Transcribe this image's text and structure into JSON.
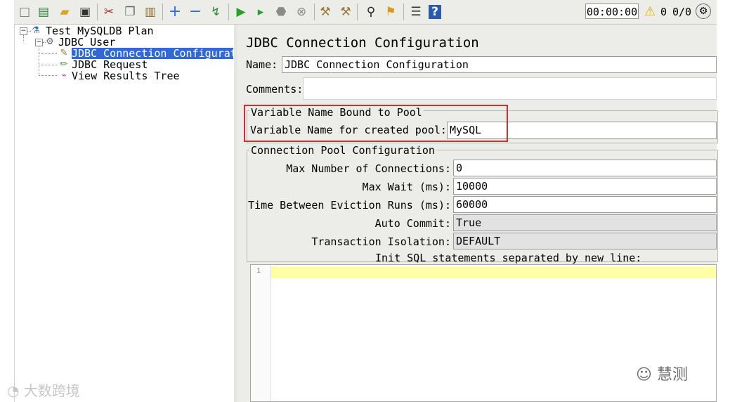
{
  "toolbar": {
    "icons": [
      "new-icon",
      "templates-icon",
      "open-icon",
      "save-icon",
      "cut-icon",
      "copy-icon",
      "paste-icon",
      "expand-icon",
      "collapse-icon",
      "toggle-icon",
      "start-icon",
      "start-no-pause-icon",
      "stop-icon",
      "shutdown-icon",
      "clear-icon",
      "clear-all-icon",
      "search-icon",
      "reset-search-icon",
      "function-helper-icon",
      "help-icon"
    ],
    "timer": "00:00:00",
    "warning_count": "0",
    "threads_ratio": "0/0"
  },
  "tree": {
    "items": [
      {
        "label": "Test MySQLDB Plan",
        "icon": "test-plan-icon"
      },
      {
        "label": "JDBC User",
        "icon": "thread-group-icon"
      },
      {
        "label": "JDBC Connection Configurati",
        "icon": "config-element-icon",
        "selected": true
      },
      {
        "label": "JDBC Request",
        "icon": "sampler-icon"
      },
      {
        "label": "View Results Tree",
        "icon": "listener-icon"
      }
    ]
  },
  "panel": {
    "title": "JDBC Connection Configuration",
    "name_label": "Name:",
    "name_value": "JDBC Connection Configuration",
    "comments_label": "Comments:",
    "comments_value": "",
    "var_group_title": "Variable Name Bound to Pool",
    "var_label": "Variable Name for created pool:",
    "var_value": "MySQL",
    "pool_group_title": "Connection Pool Configuration",
    "pool_fields": [
      {
        "label": "Max Number of Connections:",
        "value": "0",
        "type": "text"
      },
      {
        "label": "Max Wait (ms):",
        "value": "10000",
        "type": "text"
      },
      {
        "label": "Time Between Eviction Runs (ms):",
        "value": "60000",
        "type": "text"
      },
      {
        "label": "Auto Commit:",
        "value": "True",
        "type": "select"
      },
      {
        "label": "Transaction Isolation:",
        "value": "DEFAULT",
        "type": "select"
      }
    ],
    "init_sql_label": "Init SQL statements separated by new line:",
    "editor_line_number": "1"
  },
  "watermarks": {
    "right": "慧测",
    "left": "大数跨境"
  },
  "colors": {
    "selection": "#3168d5",
    "highlight_box": "#d92b2b",
    "current_line": "#ffffa8"
  }
}
